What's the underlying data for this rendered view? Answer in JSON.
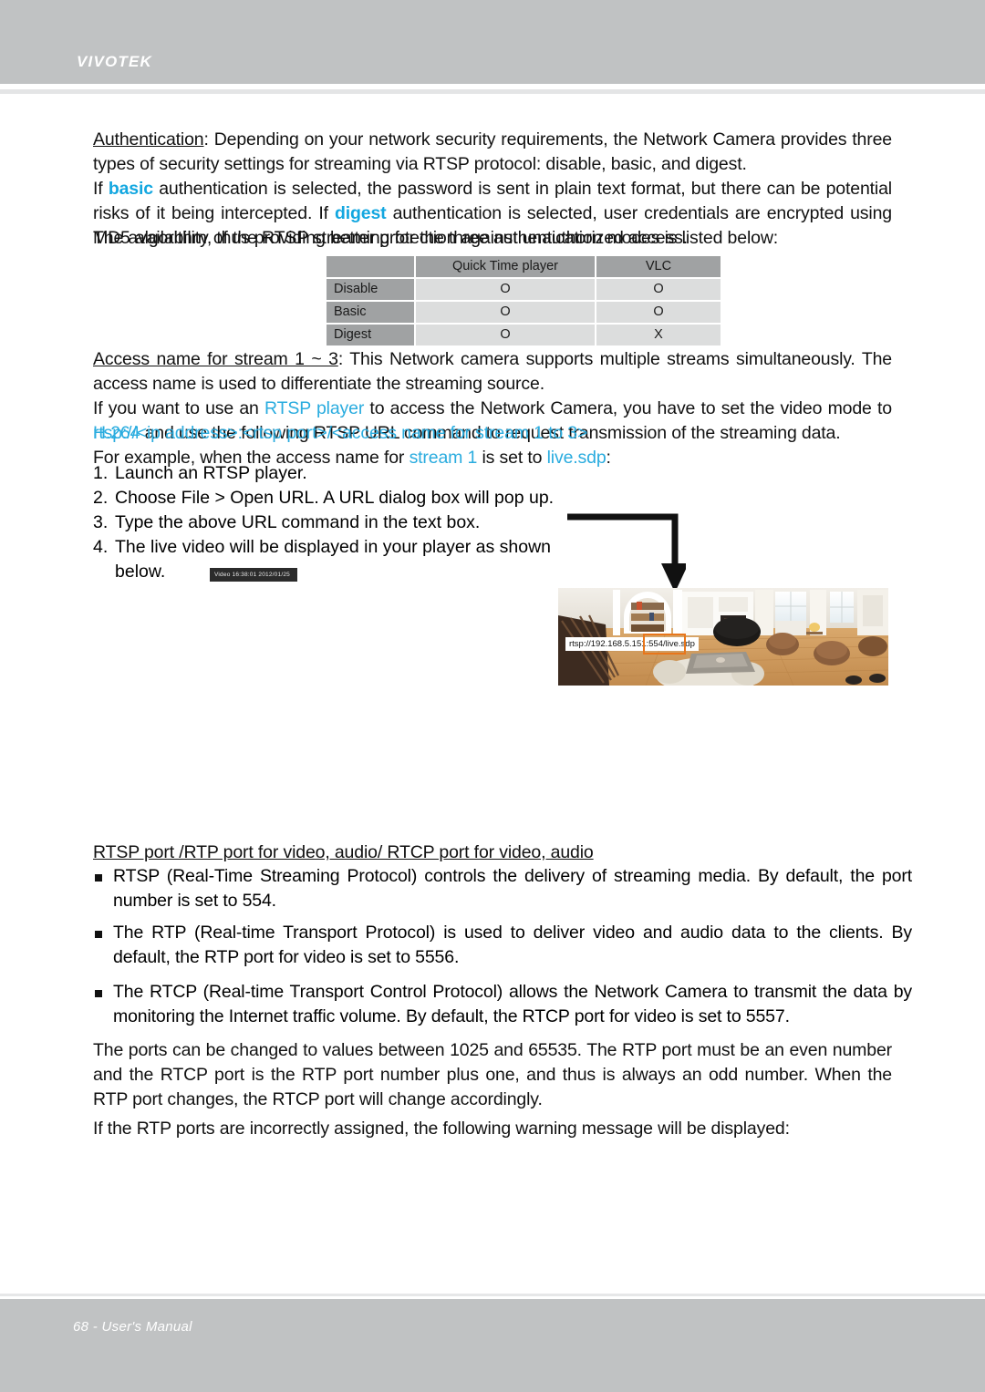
{
  "header": {
    "brand": "VIVOTEK"
  },
  "footer": {
    "page_label": "68 - User's Manual"
  },
  "body": {
    "auth_heading": "Authentication",
    "auth_p1_a": ": Depending on your network security requirements, the Network Camera provides three types of security settings for streaming via RTSP protocol: disable, basic, and digest.",
    "auth_p2_a": "If ",
    "auth_p2_basic": "basic",
    "auth_p2_b": " authentication is selected, the password is sent in plain text format, but there can be potential risks of it being intercepted. If ",
    "auth_p2_digest": "digest",
    "auth_p2_c": " authentication is selected, user credentials are encrypted using MD5 algorithm, thus providing better protection against unauthorized access.",
    "auth_p3": "The availability of the RTSP streaming for the three authentication modes is listed below:",
    "access_heading": "Access name for stream 1 ~ 3",
    "access_p1": ": This Network camera supports multiple streams simultaneously. The access name is used to differentiate the streaming source.",
    "access_p2_a": "If you want to use an ",
    "access_p2_rtsp": "RTSP player",
    "access_p2_b": " to access the Network Camera, you have to set the video mode to ",
    "access_p2_h264": "H.264",
    "access_p2_c": " and use the following RTSP URL command to request transmission of the streaming data.",
    "access_url": "rtsp://<ip address>:<rtsp port>/<access name for stream 1 to 3>",
    "access_p3_a": "For example, when the access name for ",
    "access_p3_stream": "stream 1",
    "access_p3_b": " is set to ",
    "access_p3_livesdp": "live.sdp",
    "access_p3_c": ":",
    "steps": [
      {
        "n": "1.",
        "text": "Launch an RTSP player."
      },
      {
        "n": "2.",
        "text": "Choose File > Open URL. A URL dialog box will pop up."
      },
      {
        "n": "3.",
        "text": "Type the above URL command in the text box."
      },
      {
        "n": "4.",
        "text": "The live video will be displayed in your player as shown below."
      }
    ],
    "video_window": {
      "titlebar": "Video 16:38:01 2012/01/25",
      "url_tooltip": "rtsp://192.168.5.151:554/live.sdp",
      "highlight_color": "#e8761b"
    },
    "ports_heading": "RTSP port /RTP port for video, audio/ RTCP port for video, audio",
    "bullets": [
      "RTSP (Real-Time Streaming Protocol) controls the delivery of streaming media. By default, the port number is set to 554.",
      "The RTP (Real-time Transport Protocol) is used to deliver video and audio data to the clients. By default, the RTP port for video is set to 5556.",
      "The RTCP (Real-time Transport Control Protocol) allows the Network Camera to transmit the data by monitoring the Internet traffic volume. By default, the RTCP port for video is set to 5557."
    ],
    "ports_p1": "The ports can be changed to values between 1025 and 65535. The RTP port must be an even number and the RTCP port is the RTP port number plus one, and thus is always an odd number. When the RTP port changes, the RTCP port will change accordingly.",
    "ports_p2": "If the RTP ports are incorrectly assigned, the following warning message will be displayed:"
  },
  "availability_table": {
    "columns": [
      "",
      "Quick Time player",
      "VLC"
    ],
    "rows": [
      {
        "label": "Disable",
        "values": [
          "O",
          "O"
        ]
      },
      {
        "label": "Basic",
        "values": [
          "O",
          "O"
        ]
      },
      {
        "label": "Digest",
        "values": [
          "O",
          "X"
        ]
      }
    ]
  }
}
